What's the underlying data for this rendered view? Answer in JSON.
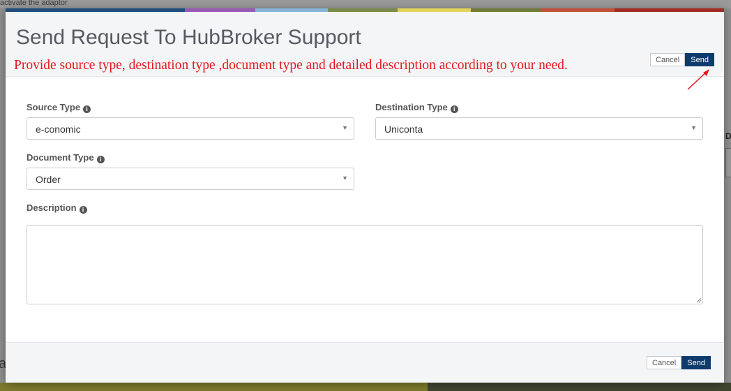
{
  "background": {
    "top_text": "activate the adaptor"
  },
  "stripe_colors": [
    "#1e4d7a",
    "#9b59b6",
    "#85b5d8",
    "#7a8a4c",
    "#e3d15a",
    "#6f7a3c",
    "#c0503c",
    "#a12a22"
  ],
  "modal": {
    "title": "Send Request To HubBroker Support",
    "note": "Provide source type, destination type ,document type and detailed description according to your need.",
    "header_buttons": {
      "cancel": "Cancel",
      "send": "Send"
    },
    "fields": {
      "source_type": {
        "label": "Source Type",
        "value": "e-conomic"
      },
      "destination_type": {
        "label": "Destination Type",
        "value": "Uniconta"
      },
      "document_type": {
        "label": "Document Type",
        "value": "Order"
      },
      "description": {
        "label": "Description",
        "value": ""
      }
    },
    "footer_buttons": {
      "cancel": "Cancel",
      "send": "Send"
    }
  },
  "icons": {
    "info": "info-circle-icon",
    "caret": "caret-down-icon",
    "annotation_arrow": "arrow-icon"
  },
  "colors": {
    "primary": "#0e3b6e",
    "note": "#e4181d"
  }
}
